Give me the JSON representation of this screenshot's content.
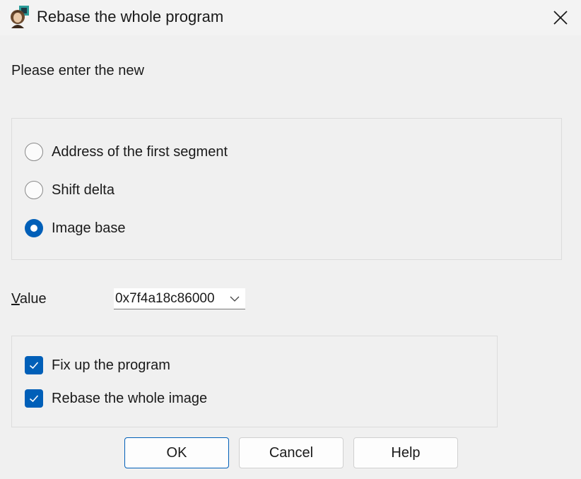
{
  "window": {
    "title": "Rebase the whole program",
    "app_icon": "ida-pro-icon",
    "close_icon": "close-icon"
  },
  "prompt": "Please enter the new",
  "mode_options": [
    {
      "label": "Address of the first segment",
      "checked": false
    },
    {
      "label": "Shift delta",
      "checked": false
    },
    {
      "label": "Image base",
      "checked": true
    }
  ],
  "value": {
    "label_first": "V",
    "label_rest": "alue",
    "selected": "0x7f4a18c86000"
  },
  "options": [
    {
      "label": "Fix up the program",
      "checked": true
    },
    {
      "label": "Rebase the whole image",
      "checked": true
    }
  ],
  "buttons": {
    "ok": "OK",
    "cancel": "Cancel",
    "help": "Help"
  },
  "colors": {
    "accent": "#005fb8",
    "background": "#f0f0f0"
  }
}
